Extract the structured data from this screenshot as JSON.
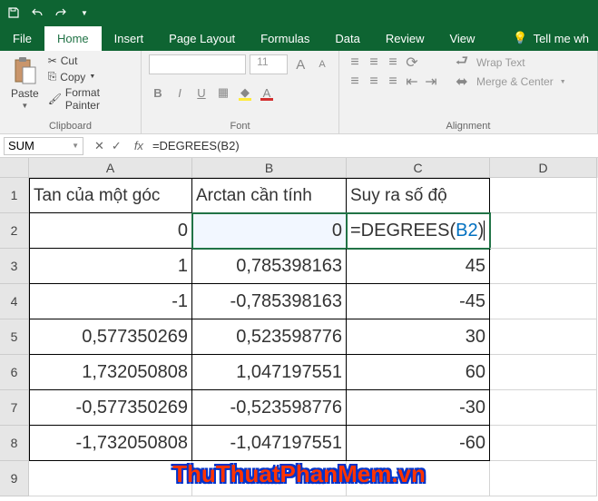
{
  "qat": {
    "save": "save-icon",
    "undo": "undo-icon",
    "redo": "redo-icon"
  },
  "tabs": {
    "file": "File",
    "home": "Home",
    "insert": "Insert",
    "pagelayout": "Page Layout",
    "formulas": "Formulas",
    "data": "Data",
    "review": "Review",
    "view": "View",
    "tellme": "Tell me wh"
  },
  "ribbon": {
    "clipboard": {
      "paste": "Paste",
      "cut": "Cut",
      "copy": "Copy",
      "painter": "Format Painter",
      "label": "Clipboard"
    },
    "font": {
      "label": "Font",
      "sizeA": "A",
      "sizea": "A"
    },
    "alignment": {
      "wrap": "Wrap Text",
      "merge": "Merge & Center",
      "label": "Alignment"
    }
  },
  "namebox": "SUM",
  "fx": "fx",
  "formula_text": "=DEGREES(B2)",
  "cols": [
    "A",
    "B",
    "C",
    "D"
  ],
  "headers": {
    "a": "Tan của một góc",
    "b": "Arctan cần tính",
    "c": "Suy ra số độ"
  },
  "editing": {
    "prefix": "=DEGREES(",
    "ref": "B2",
    "suffix": ")"
  },
  "rows": [
    {
      "a": "0",
      "b": "0"
    },
    {
      "a": "1",
      "b": "0,785398163",
      "c": "45"
    },
    {
      "a": "-1",
      "b": "-0,785398163",
      "c": "-45"
    },
    {
      "a": "0,577350269",
      "b": "0,523598776",
      "c": "30"
    },
    {
      "a": "1,732050808",
      "b": "1,047197551",
      "c": "60"
    },
    {
      "a": "-0,577350269",
      "b": "-0,523598776",
      "c": "-30"
    },
    {
      "a": "-1,732050808",
      "b": "-1,047197551",
      "c": "-60"
    }
  ],
  "watermark": "ThuThuatPhanMem.vn",
  "chart_data": {
    "type": "table",
    "title": "Arctan / Degrees lookup",
    "columns": [
      "Tan của một góc",
      "Arctan cần tính",
      "Suy ra số độ"
    ],
    "data": [
      [
        0,
        0,
        null
      ],
      [
        1,
        0.785398163,
        45
      ],
      [
        -1,
        -0.785398163,
        -45
      ],
      [
        0.577350269,
        0.523598776,
        30
      ],
      [
        1.732050808,
        1.047197551,
        60
      ],
      [
        -0.577350269,
        -0.523598776,
        -30
      ],
      [
        -1.732050808,
        -1.047197551,
        -60
      ]
    ],
    "note": "C2 is being edited with formula =DEGREES(B2)"
  }
}
